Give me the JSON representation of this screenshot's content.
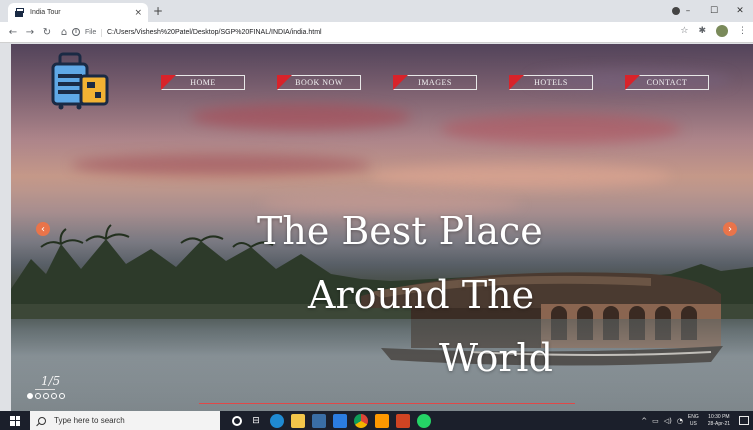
{
  "browser": {
    "tab_title": "India Tour",
    "tab_close": "×",
    "new_tab": "+",
    "file_label": "File",
    "url": "C:/Users/Vishesh%20Patel/Desktop/SGP%20FINAL/INDIA/india.html",
    "window_controls": [
      "–",
      "☐",
      "✕"
    ]
  },
  "nav": {
    "items": [
      "HOME",
      "BOOK NOW",
      "IMAGES",
      "HOTELS",
      "CONTACT"
    ],
    "accent_color": "#d8232a"
  },
  "hero": {
    "line1": "The Best Place",
    "line2": "Around The",
    "line3": "World"
  },
  "slider": {
    "counter": "1/5",
    "slide_count": 5,
    "active_slide": 1,
    "arrow_color": "#e9744a"
  },
  "taskbar": {
    "search_placeholder": "Type here to search",
    "lang_top": "ENG",
    "lang_bottom": "US",
    "time": "10:30 PM",
    "date": "28-Apr-21"
  }
}
